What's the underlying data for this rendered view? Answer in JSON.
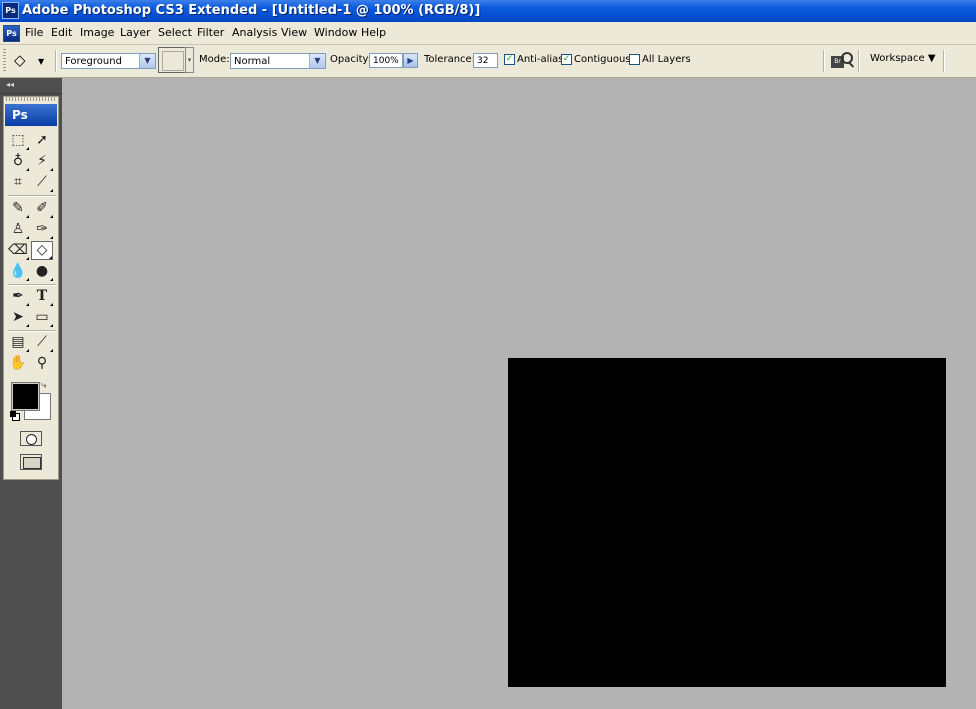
{
  "app": {
    "title": "Adobe Photoshop CS3 Extended - [Untitled-1 @ 100% (RGB/8)]",
    "logo_text": "Ps"
  },
  "menubar": {
    "icon_text": "Ps",
    "items": [
      "File",
      "Edit",
      "Image",
      "Layer",
      "Select",
      "Filter",
      "Analysis",
      "View",
      "Window",
      "Help"
    ]
  },
  "options": {
    "tool_icon": "paint-bucket-icon",
    "fill_source": "Foreground",
    "mode_label": "Mode:",
    "mode_value": "Normal",
    "opacity_label": "Opacity:",
    "opacity_value": "100%",
    "tolerance_label": "Tolerance:",
    "tolerance_value": "32",
    "anti_alias_label": "Anti-alias",
    "anti_alias_checked": true,
    "contiguous_label": "Contiguous",
    "contiguous_checked": true,
    "all_layers_label": "All Layers",
    "all_layers_checked": false,
    "workspace_label": "Workspace ▼"
  },
  "toolbox": {
    "badge": "Ps",
    "active_tool": "paint-bucket",
    "foreground_color": "#000000",
    "background_color": "#ffffff"
  },
  "document": {
    "canvas_color": "#000000",
    "workspace_color": "#b3b3b3"
  },
  "colors": {
    "title_bar": "#0a55d8",
    "chrome": "#ece9d8",
    "dock": "#4f4f4f"
  }
}
